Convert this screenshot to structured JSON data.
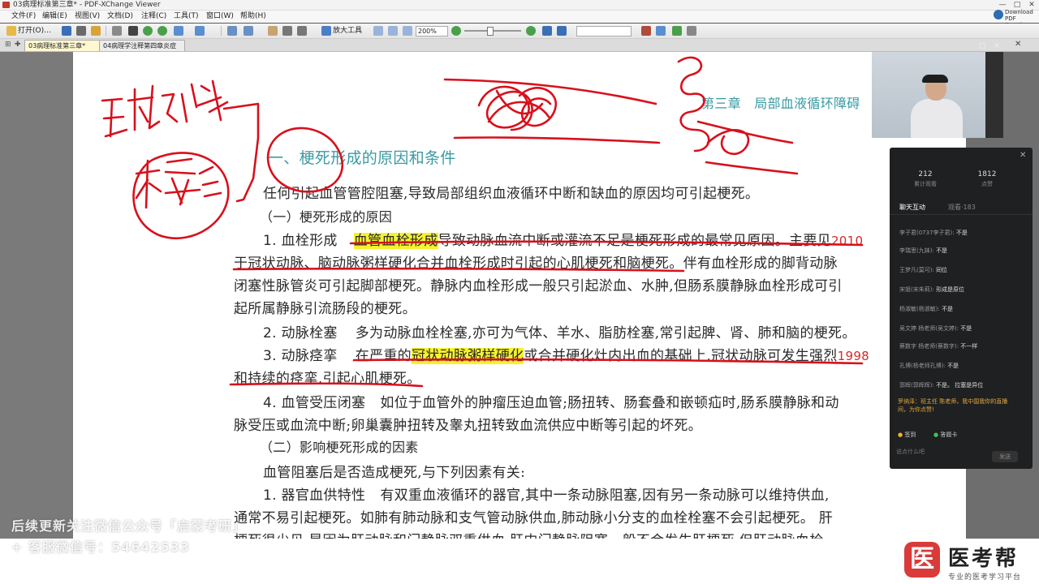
{
  "window": {
    "title": "03病理标准第三章* - PDF-XChange Viewer",
    "controls": [
      "—",
      "□",
      "✕"
    ]
  },
  "menu": [
    "文件(F)",
    "编辑(E)",
    "视图(V)",
    "文档(D)",
    "注释(C)",
    "工具(T)",
    "窗口(W)",
    "帮助(H)"
  ],
  "download_promo": "Download PDF Creation Tools",
  "toolbar": {
    "open_label": "打开(O)...",
    "zoom_tool_label": "放大工具",
    "zoom_value": "200%"
  },
  "tabs": [
    {
      "label": "03病理标准第三章*",
      "active": true
    },
    {
      "label": "04病理学注释第四章炎症",
      "active": false
    }
  ],
  "document": {
    "running_header": "第三章　局部血液循环障碍",
    "section_title": "一、梗死形成的原因和条件",
    "intro": "任何引起血管管腔阻塞,导致局部组织血液循环中断和缺血的原因均可引起梗死。",
    "sub1": "（一）梗死形成的原因",
    "p1_label": "1. 血栓形成",
    "p1_hl": "血管血栓形成",
    "p1_rest": "导致动脉血流中断或灌流不足是梗死形成的最常见原因。主要见",
    "p1_year": "2010",
    "p1_line2": "于冠状动脉、脑动脉粥样硬化合并血栓形成时引起的心肌梗死和脑梗死。伴有血栓形成的脚背动脉",
    "p1_line3": "闭塞性脉管炎可引起脚部梗死。静脉内血栓形成一般只引起淤血、水肿,但肠系膜静脉血栓形成可引",
    "p1_line4": "起所属静脉引流肠段的梗死。",
    "p2_label": "2. 动脉栓塞",
    "p2_text": "多为动脉血栓栓塞,亦可为气体、羊水、脂肪栓塞,常引起脾、肾、肺和脑的梗死。",
    "p3_label": "3. 动脉痉挛",
    "p3_pre": "在严重的",
    "p3_hl": "冠状动脉粥样硬化",
    "p3_rest": "或合并硬化灶内出血的基础上,冠状动脉可发生强烈",
    "p3_year": "1998",
    "p3_line2": "和持续的痉挛,引起心肌梗死。",
    "p4_label": "4. 血管受压闭塞",
    "p4_text": "如位于血管外的肿瘤压迫血管;肠扭转、肠套叠和嵌顿疝时,肠系膜静脉和动",
    "p4_line2": "脉受压或血流中断;卵巢囊肿扭转及睾丸扭转致血流供应中断等引起的坏死。",
    "sub2": "（二）影响梗死形成的因素",
    "factors_intro": "血管阻塞后是否造成梗死,与下列因素有关:",
    "f1_label": "1. 器官血供特性",
    "f1_text": "有双重血液循环的器官,其中一条动脉阻塞,因有另一条动脉可以维持供血,",
    "f1_line2": "通常不易引起梗死。如肺有肺动脉和支气管动脉供血,肺动脉小分支的血栓栓塞不会引起梗死。 肝",
    "f1_line3": "梗死很少见,是因为肝动脉和门静脉双重供血,肝内门静脉阻塞一般不会发生肝梗死,但肝动脉血栓"
  },
  "annotations": {
    "handwriting_1": "互栓形成",
    "handwriting_2": "栓塞"
  },
  "live_panel": {
    "stats": [
      {
        "value": "212",
        "label": "累计观看"
      },
      {
        "value": "1812",
        "label": "点赞"
      }
    ],
    "tabs": [
      "聊天互动",
      "观看·183"
    ],
    "messages": [
      {
        "user": "李子君(0737李子君)",
        "text": "不是"
      },
      {
        "user": "李瑞思(九妹)",
        "text": "不是"
      },
      {
        "user": "王梦凡(莫可)",
        "text": "同位"
      },
      {
        "user": "宋姐(宋朱莉)",
        "text": "形成是原位"
      },
      {
        "user": "杨淑敏(杨淑敏)",
        "text": "不是"
      },
      {
        "user": "吴文婷 杨老师(吴文婷)",
        "text": "不是"
      },
      {
        "user": "蔡数字 杨老师(蔡数字)",
        "text": "不一样"
      },
      {
        "user": "孔博(杨老师孔博)",
        "text": "不是"
      },
      {
        "user": "郭辉(郭辉辉)",
        "text": "不是。 拉塞是异位"
      }
    ],
    "notice": "罗纳泽：班主任 陈老师，我中国我你的直播间，为你点赞!",
    "buttons": [
      "签到",
      "答题卡"
    ],
    "input_placeholder": "说点什么吧",
    "send_label": "发送"
  },
  "watermark": {
    "line1": "后续更新关注微信公众号「启蒙考研」",
    "line2": "+ 客服微信号：54642533"
  },
  "brand": {
    "badge": "医",
    "name": "医考帮",
    "tagline": "专业的医考学习平台"
  },
  "colors": {
    "highlight": "#f5f22e",
    "ink": "#d8101c",
    "heading": "#3a9aa3"
  }
}
